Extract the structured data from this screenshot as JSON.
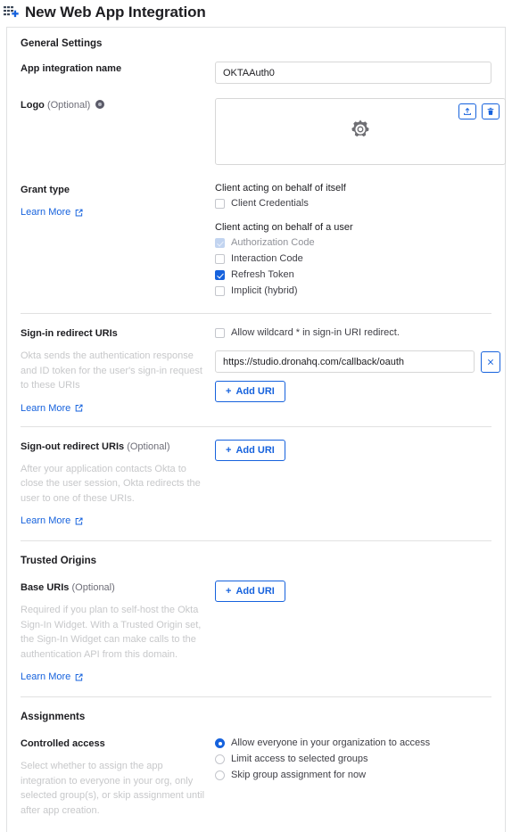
{
  "page": {
    "title": "New Web App Integration",
    "title_icon": "app-grid-plus-icon"
  },
  "general_settings": {
    "heading": "General Settings",
    "app_name": {
      "label": "App integration name",
      "value": "OKTAAuth0",
      "placeholder": ""
    },
    "logo": {
      "label": "Logo",
      "optional": "(Optional)",
      "info_icon": "info-circle-icon",
      "placeholder_icon": "gear-icon",
      "upload_icon": "upload-icon",
      "delete_icon": "trash-icon"
    },
    "grant_type": {
      "label": "Grant type",
      "learn_more": "Learn More",
      "groups": [
        {
          "caption": "Client acting on behalf of itself",
          "options": [
            {
              "label": "Client Credentials",
              "checked": false,
              "disabled": false
            }
          ]
        },
        {
          "caption": "Client acting on behalf of a user",
          "options": [
            {
              "label": "Authorization Code",
              "checked": true,
              "disabled": true
            },
            {
              "label": "Interaction Code",
              "checked": false,
              "disabled": false
            },
            {
              "label": "Refresh Token",
              "checked": true,
              "disabled": false
            },
            {
              "label": "Implicit (hybrid)",
              "checked": false,
              "disabled": false
            }
          ]
        }
      ]
    }
  },
  "signin_redirect": {
    "label": "Sign-in redirect URIs",
    "hint": "Okta sends the authentication response and ID token for the user's sign-in request to these URIs",
    "learn_more": "Learn More",
    "wildcard": {
      "label": "Allow wildcard * in sign-in URI redirect.",
      "checked": false
    },
    "uris": [
      {
        "value": "https://studio.dronahq.com/callback/oauth",
        "remove_icon": "close-icon"
      }
    ],
    "add_button": "Add URI"
  },
  "signout_redirect": {
    "label": "Sign-out redirect URIs",
    "optional": "(Optional)",
    "hint": "After your application contacts Okta to close the user session, Okta redirects the user to one of these URIs.",
    "learn_more": "Learn More",
    "add_button": "Add URI"
  },
  "trusted_origins": {
    "heading": "Trusted Origins",
    "base_uris": {
      "label": "Base URIs",
      "optional": "(Optional)",
      "hint": "Required if you plan to self-host the Okta Sign-In Widget. With a Trusted Origin set, the Sign-In Widget can make calls to the authentication API from this domain.",
      "learn_more": "Learn More",
      "add_button": "Add URI"
    }
  },
  "assignments": {
    "heading": "Assignments",
    "controlled_access": {
      "label": "Controlled access",
      "hint": "Select whether to assign the app integration to everyone in your org, only selected group(s), or skip assignment until after app creation.",
      "options": [
        {
          "label": "Allow everyone in your organization to access",
          "selected": true
        },
        {
          "label": "Limit access to selected groups",
          "selected": false
        },
        {
          "label": "Skip group assignment for now",
          "selected": false
        }
      ]
    }
  },
  "colors": {
    "accent": "#1662dd",
    "text": "#1d1d21",
    "muted": "#c7c8ca",
    "border": "#d7d7d7"
  }
}
